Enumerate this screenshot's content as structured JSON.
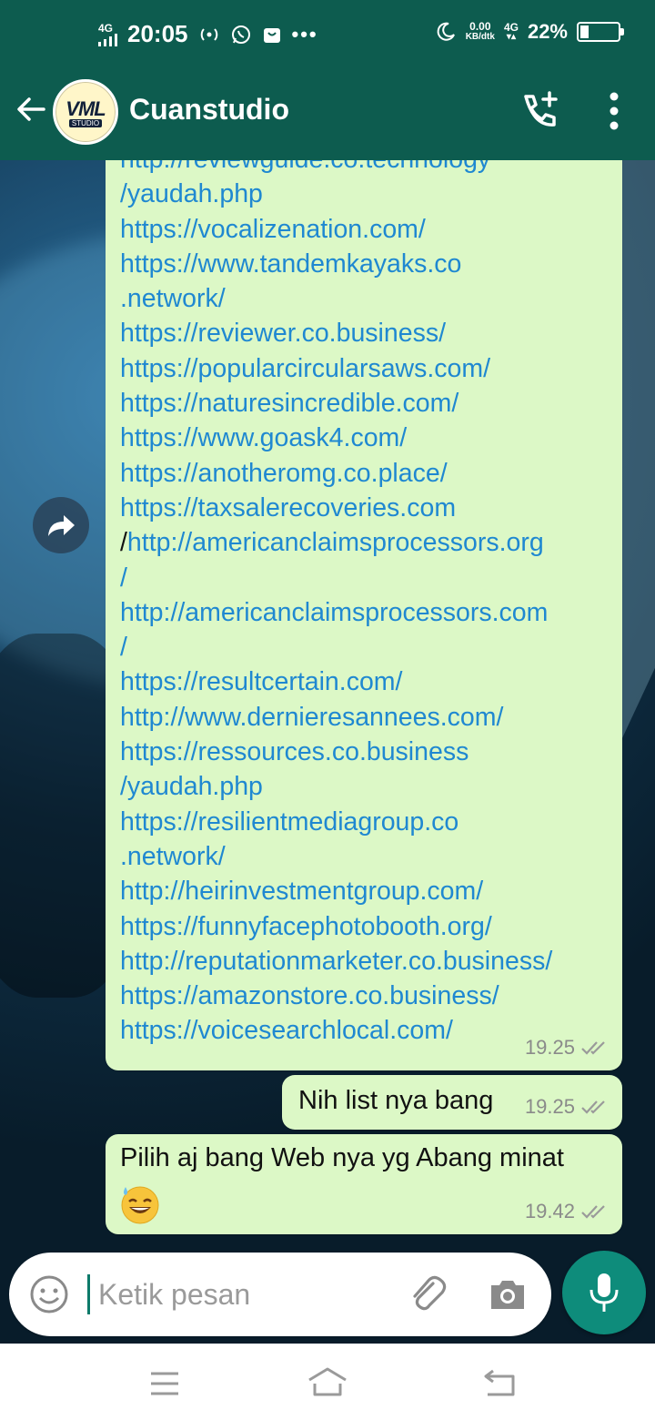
{
  "status_bar": {
    "network_left": "4G",
    "time": "20:05",
    "speed_value": "0.00",
    "speed_unit": "KB/dtk",
    "network_right": "4G",
    "battery_percent": "22%",
    "battery_level": 0.22
  },
  "app_bar": {
    "avatar_text": "VML",
    "avatar_sub": "STUDIO",
    "contact_name": "Cuanstudio"
  },
  "messages": {
    "links": {
      "lines": [
        "http://reviewguide.co.technology",
        "/yaudah.php",
        "https://vocalizenation.com/",
        "https://www.tandemkayaks.co",
        ".network/",
        "https://reviewer.co.business/",
        "https://popularcircularsaws.com/",
        "https://naturesincredible.com/",
        "https://www.goask4.com/",
        "https://anotheromg.co.place/",
        "https://taxsalerecoveries.com",
        "http://americanclaimsprocessors.org",
        "/",
        "http://americanclaimsprocessors.com",
        "/",
        "https://resultcertain.com/",
        "http://www.dernieresannees.com/",
        "https://ressources.co.business",
        "/yaudah.php",
        "https://resilientmediagroup.co",
        ".network/",
        "http://heirinvestmentgroup.com/",
        "https://funnyfacephotobooth.org/",
        "http://reputationmarketer.co.business/",
        "https://amazonstore.co.business/",
        "https://voicesearchlocal.com/"
      ],
      "slash_prefix": "/",
      "time": "19.25"
    },
    "list_msg": {
      "text": "Nih list nya bang",
      "time": "19.25"
    },
    "choose_msg": {
      "text": "Pilih aj bang Web nya  yg Abang minat",
      "time": "19.42"
    }
  },
  "composer": {
    "placeholder": "Ketik pesan"
  },
  "colors": {
    "header": "#0d5c4f",
    "bubble": "#dcf8c6",
    "link": "#1f88d1",
    "mic": "#0e8c7b"
  }
}
